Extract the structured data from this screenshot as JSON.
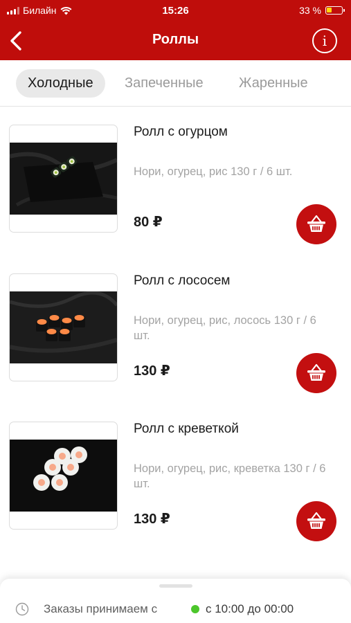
{
  "status_bar": {
    "carrier": "Билайн",
    "time": "15:26",
    "battery_percent": "33 %",
    "battery_level": 0.33,
    "battery_color": "#ffd60a"
  },
  "nav": {
    "title": "Роллы",
    "back_icon": "chevron-left",
    "info_icon": "info",
    "info_glyph": "i",
    "background_color": "#bf0d0b"
  },
  "tabs": [
    {
      "label": "Холодные",
      "active": true
    },
    {
      "label": "Запеченные",
      "active": false
    },
    {
      "label": "Жаренные",
      "active": false
    }
  ],
  "products": [
    {
      "name": "Ролл с огурцом",
      "description": "Нори, огурец, рис 130 г / 6 шт.",
      "price": "80 ₽"
    },
    {
      "name": "Ролл с лососем",
      "description": "Нори, огурец, рис, лосось 130 г / 6 шт.",
      "price": "130 ₽"
    },
    {
      "name": "Ролл с креветкой",
      "description": "Нори, огурец, рис, креветка 130 г / 6 шт.",
      "price": "130 ₽"
    }
  ],
  "cart_button": {
    "icon": "basket-icon",
    "color": "#c30f10"
  },
  "bottom_sheet": {
    "hours_label": "Заказы принимаем с",
    "hours_value": "с 10:00 до 00:00",
    "status_color": "#4cc62b"
  }
}
